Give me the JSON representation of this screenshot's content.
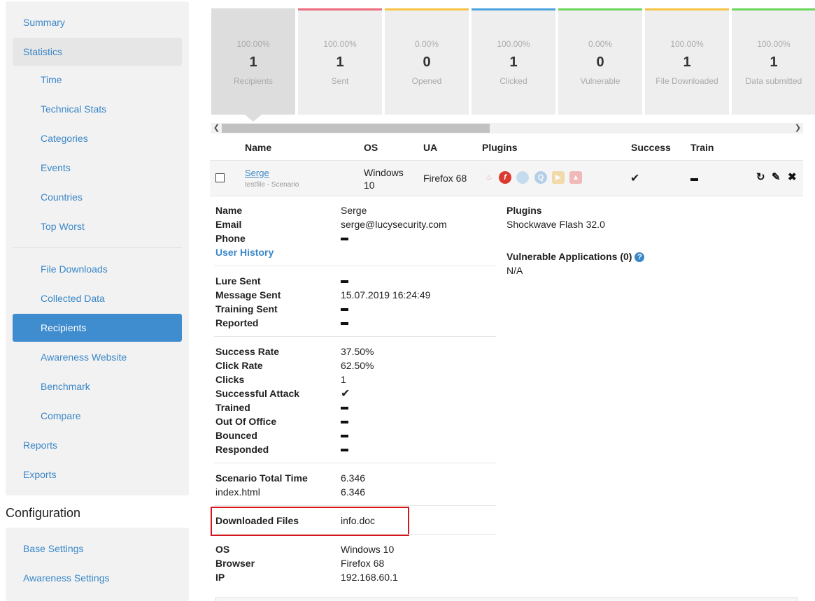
{
  "sidebar": {
    "summary": "Summary",
    "statistics": "Statistics",
    "time": "Time",
    "technical_stats": "Technical Stats",
    "categories": "Categories",
    "events": "Events",
    "countries": "Countries",
    "top_worst": "Top Worst",
    "file_downloads": "File Downloads",
    "collected_data": "Collected Data",
    "recipients": "Recipients",
    "awareness_website": "Awareness Website",
    "benchmark": "Benchmark",
    "compare": "Compare",
    "reports": "Reports",
    "exports": "Exports"
  },
  "configuration": {
    "heading": "Configuration",
    "base_settings": "Base Settings",
    "awareness_settings": "Awareness Settings"
  },
  "cards": [
    {
      "pct": "100.00%",
      "num": "1",
      "label": "Recipients",
      "color": "#dddddd"
    },
    {
      "pct": "100.00%",
      "num": "1",
      "label": "Sent",
      "color": "#ee6b7d"
    },
    {
      "pct": "0.00%",
      "num": "0",
      "label": "Opened",
      "color": "#f6c343"
    },
    {
      "pct": "100.00%",
      "num": "1",
      "label": "Clicked",
      "color": "#4aa3df"
    },
    {
      "pct": "0.00%",
      "num": "0",
      "label": "Vulnerable",
      "color": "#6bd65b"
    },
    {
      "pct": "100.00%",
      "num": "1",
      "label": "File Downloaded",
      "color": "#f6c343"
    },
    {
      "pct": "100.00%",
      "num": "1",
      "label": "Data submitted",
      "color": "#6bd65b"
    }
  ],
  "table": {
    "headers": {
      "name": "Name",
      "os": "OS",
      "ua": "UA",
      "plugins": "Plugins",
      "success": "Success",
      "train": "Train"
    },
    "row": {
      "name": "Serge",
      "sub": "testfile - Scenario",
      "os_line1": "Windows",
      "os_line2": "10",
      "ua": "Firefox 68",
      "success": "✔"
    }
  },
  "details": {
    "name_label": "Name",
    "name_value": "Serge",
    "email_label": "Email",
    "email_value": "serge@lucysecurity.com",
    "phone_label": "Phone",
    "user_history": "User History",
    "lure_sent_label": "Lure Sent",
    "message_sent_label": "Message Sent",
    "message_sent_value": "15.07.2019 16:24:49",
    "training_sent_label": "Training Sent",
    "reported_label": "Reported",
    "success_rate_label": "Success Rate",
    "success_rate_value": "37.50%",
    "click_rate_label": "Click Rate",
    "click_rate_value": "62.50%",
    "clicks_label": "Clicks",
    "clicks_value": "1",
    "successful_attack_label": "Successful Attack",
    "successful_attack_value": "✔",
    "trained_label": "Trained",
    "out_of_office_label": "Out Of Office",
    "bounced_label": "Bounced",
    "responded_label": "Responded",
    "scenario_total_time_label": "Scenario Total Time",
    "scenario_total_time_value": "6.346",
    "index_label": "index.html",
    "index_value": "6.346",
    "downloaded_files_label": "Downloaded Files",
    "downloaded_files_value": "info.doc",
    "os_label": "OS",
    "os_value": "Windows 10",
    "browser_label": "Browser",
    "browser_value": "Firefox 68",
    "ip_label": "IP",
    "ip_value": "192.168.60.1",
    "plugins_label": "Plugins",
    "plugins_value": "Shockwave Flash 32.0",
    "vuln_apps_label": "Vulnerable Applications (0)",
    "vuln_apps_value": "N/A"
  }
}
